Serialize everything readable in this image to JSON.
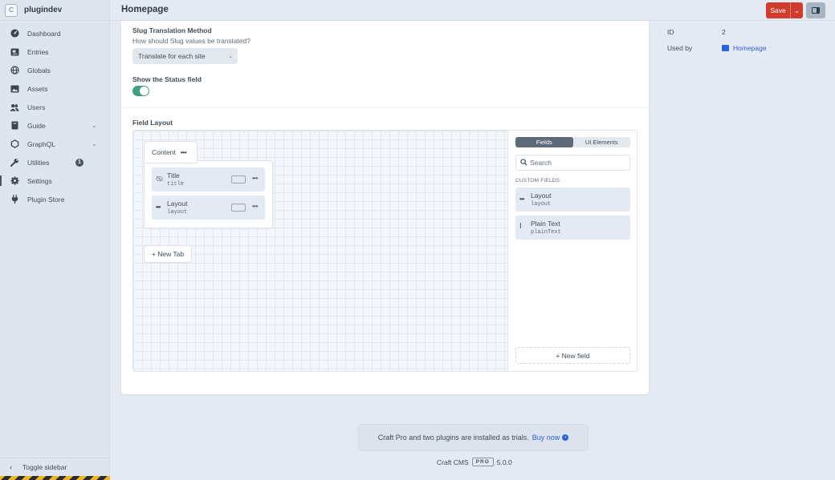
{
  "sidebar": {
    "site_initial": "C",
    "site_name": "plugindev",
    "items": [
      {
        "label": "Dashboard",
        "icon": "gauge-icon"
      },
      {
        "label": "Entries",
        "icon": "newspaper-icon"
      },
      {
        "label": "Globals",
        "icon": "globe-icon"
      },
      {
        "label": "Assets",
        "icon": "image-icon"
      },
      {
        "label": "Users",
        "icon": "users-icon"
      },
      {
        "label": "Guide",
        "icon": "book-icon",
        "expandable": true
      },
      {
        "label": "GraphQL",
        "icon": "graphql-icon",
        "expandable": true
      },
      {
        "label": "Utilities",
        "icon": "wrench-icon",
        "badge": "1"
      },
      {
        "label": "Settings",
        "icon": "gear-icon",
        "active": true
      },
      {
        "label": "Plugin Store",
        "icon": "plug-icon"
      }
    ],
    "toggle_label": "Toggle sidebar"
  },
  "header": {
    "title": "Homepage",
    "save_label": "Save",
    "accent": "#cf3c2e"
  },
  "form": {
    "slug_label": "Slug Translation Method",
    "slug_instructions": "How should Slug values be translated?",
    "slug_value": "Translate for each site",
    "status_label": "Show the Status field",
    "status_enabled": true,
    "field_layout_label": "Field Layout"
  },
  "layout": {
    "tab_name": "Content",
    "fields": [
      {
        "name": "Title",
        "handle": "title",
        "icon": "eye-slash-icon"
      },
      {
        "name": "Layout",
        "handle": "layout",
        "icon": "dots-icon"
      }
    ],
    "new_tab_label": "+ New Tab"
  },
  "library": {
    "tabs": [
      "Fields",
      "UI Elements"
    ],
    "active_tab": "Fields",
    "search_placeholder": "Search",
    "heading": "CUSTOM FIELDS",
    "fields": [
      {
        "name": "Layout",
        "handle": "layout",
        "icon": "dots-icon"
      },
      {
        "name": "Plain Text",
        "handle": "plainText",
        "icon": "text-cursor-icon"
      }
    ],
    "new_field_label": "+ New field"
  },
  "details": {
    "id_label": "ID",
    "id_value": "2",
    "used_by_label": "Used by",
    "used_by_value": "Homepage"
  },
  "footer": {
    "trial_text": "Craft Pro and two plugins are installed as trials.",
    "buy_label": "Buy now",
    "cms_name": "Craft CMS",
    "edition": "PRO",
    "version": "5.0.0"
  }
}
